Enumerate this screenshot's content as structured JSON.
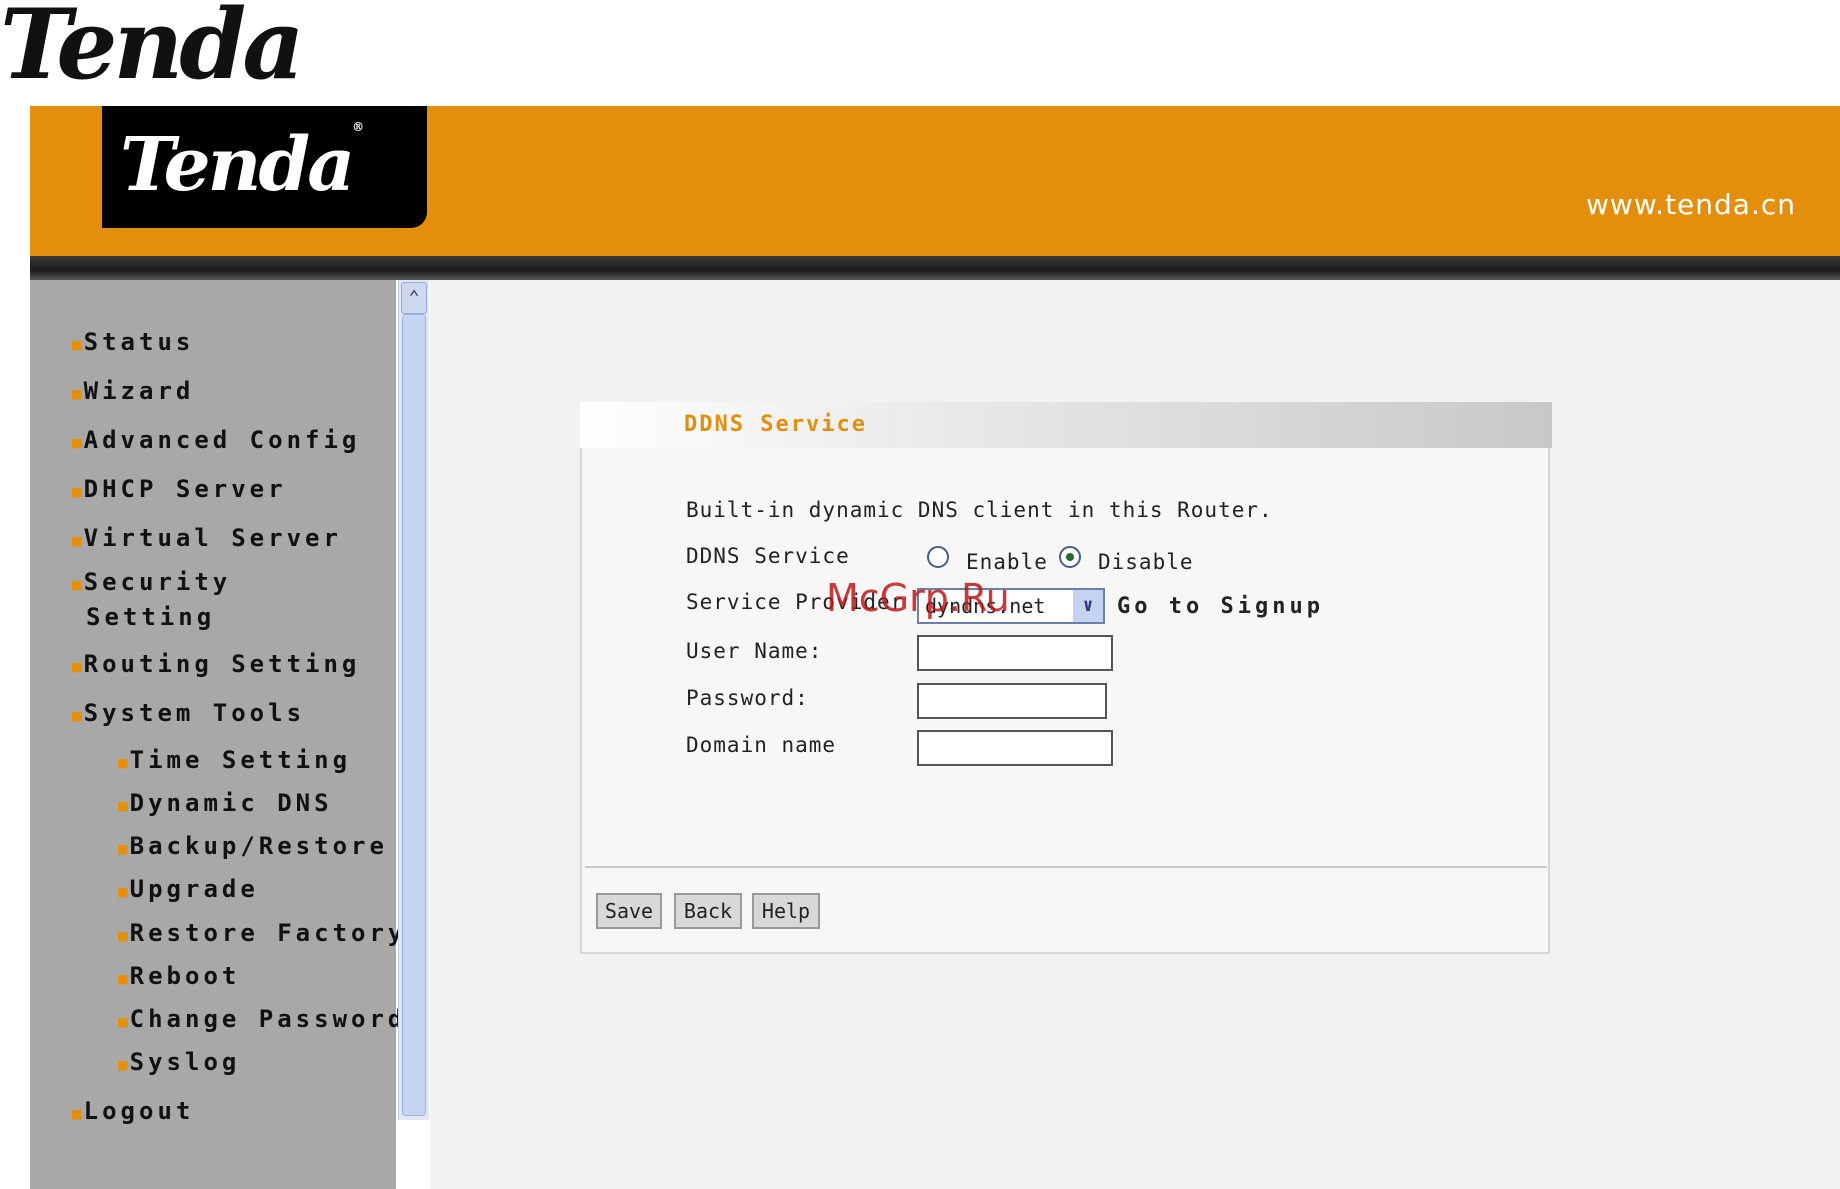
{
  "outer_logo": {
    "text": "Tenda",
    "mark": "®"
  },
  "header": {
    "logo_text": "Tenda",
    "logo_mark": "®",
    "url": "www.tenda.cn"
  },
  "sidebar": {
    "items": [
      {
        "label": "Status"
      },
      {
        "label": "Wizard"
      },
      {
        "label": "Advanced Config"
      },
      {
        "label": "DHCP Server"
      },
      {
        "label": "Virtual Server"
      },
      {
        "label": "Security"
      },
      {
        "label": "Setting"
      },
      {
        "label": "Routing Setting"
      },
      {
        "label": "System Tools"
      },
      {
        "label": "Time Setting"
      },
      {
        "label": "Dynamic DNS"
      },
      {
        "label": "Backup/Restore"
      },
      {
        "label": "Upgrade"
      },
      {
        "label": "Restore Factory"
      },
      {
        "label": "Reboot"
      },
      {
        "label": "Change Password"
      },
      {
        "label": "Syslog"
      },
      {
        "label": "Logout"
      }
    ],
    "bullet": "■"
  },
  "panel": {
    "title": "DDNS Service",
    "description": "Built-in dynamic DNS client in this Router.",
    "ddns_label": "DDNS Service",
    "enable_label": "Enable",
    "disable_label": "Disable",
    "ddns_selected": "Disable",
    "provider_label": "Service Provider",
    "provider_value": "dyndns.net",
    "signup_link": "Go to Signup",
    "username_label": "User Name:",
    "password_label": "Password:",
    "domain_label": "Domain name",
    "username_value": "",
    "password_value": "",
    "domain_value": ""
  },
  "buttons": {
    "save": "Save",
    "back": "Back",
    "help": "Help"
  },
  "watermark": "McGrp.Ru",
  "colors": {
    "accent": "#e38f0b",
    "sidebar": "#a8a8a8"
  }
}
